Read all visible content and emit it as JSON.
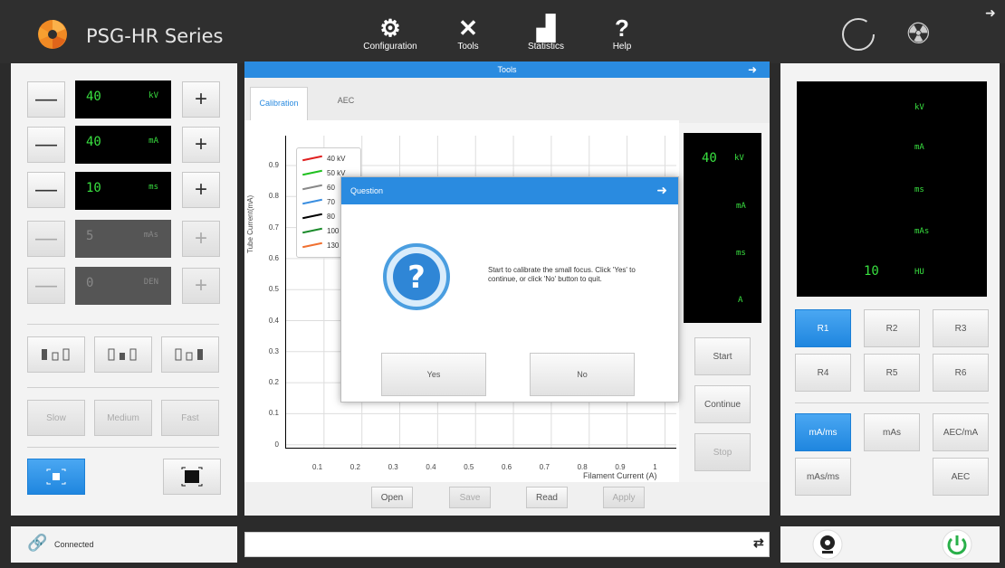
{
  "app": {
    "title": "PSG-HR Series",
    "nav": [
      {
        "label": "Configuration",
        "icon": "configuration-icon"
      },
      {
        "label": "Tools",
        "icon": "tools-icon"
      },
      {
        "label": "Statistics",
        "icon": "statistics-icon"
      },
      {
        "label": "Help",
        "icon": "help-icon"
      }
    ]
  },
  "left": {
    "kv": {
      "value": "40",
      "unit": "kV"
    },
    "ma": {
      "value": "40",
      "unit": "mA"
    },
    "ms": {
      "value": "10",
      "unit": "ms"
    },
    "mas": {
      "value": "5",
      "unit": "mAs"
    },
    "den": {
      "value": "0",
      "unit": "DEN"
    },
    "speed": [
      "Slow",
      "Medium",
      "Fast"
    ],
    "minus": "—",
    "plus": "+"
  },
  "tools": {
    "title": "Tools",
    "tabs": [
      "Calibration",
      "AEC"
    ],
    "ylabel": "Tube Current(mA)",
    "xlabel": "Filament Current (A)",
    "yticks": [
      "0.9",
      "0.8",
      "0.7",
      "0.6",
      "0.5",
      "0.4",
      "0.3",
      "0.2",
      "0.1",
      "0"
    ],
    "xticks": [
      "0.1",
      "0.2",
      "0.3",
      "0.4",
      "0.5",
      "0.6",
      "0.7",
      "0.8",
      "0.9",
      "1"
    ],
    "legend": [
      {
        "label": "40 kV",
        "color": "#e02020"
      },
      {
        "label": "50 kV",
        "color": "#20c020"
      },
      {
        "label": "60",
        "color": "#888888"
      },
      {
        "label": "70",
        "color": "#3a8ee0"
      },
      {
        "label": "80",
        "color": "#000000"
      },
      {
        "label": "100",
        "color": "#1a8a2a"
      },
      {
        "label": "130",
        "color": "#f07030"
      }
    ],
    "lcd": {
      "kv_value": "40",
      "kv_unit": "kV",
      "ma_unit": "mA",
      "ms_unit": "ms",
      "a_unit": "A"
    },
    "side_buttons": [
      "Start",
      "Continue",
      "Stop"
    ],
    "bottom_buttons": [
      "Open",
      "Save",
      "Read",
      "Apply"
    ]
  },
  "dialog": {
    "title": "Question",
    "message": "Start to calibrate the small focus. Click 'Yes' to continue, or click 'No' button to quit.",
    "yes": "Yes",
    "no": "No"
  },
  "right": {
    "lcd": {
      "kv": "kV",
      "ma": "mA",
      "ms": "ms",
      "mas": "mAs",
      "hu_value": "10",
      "hu": "HU"
    },
    "regions": [
      "R1",
      "R2",
      "R3",
      "R4",
      "R5",
      "R6"
    ],
    "modes": [
      "mA/ms",
      "mAs",
      "AEC/mA",
      "mAs/ms",
      "AEC"
    ]
  },
  "status": {
    "connection": "Connected",
    "refresh": "⇄"
  }
}
